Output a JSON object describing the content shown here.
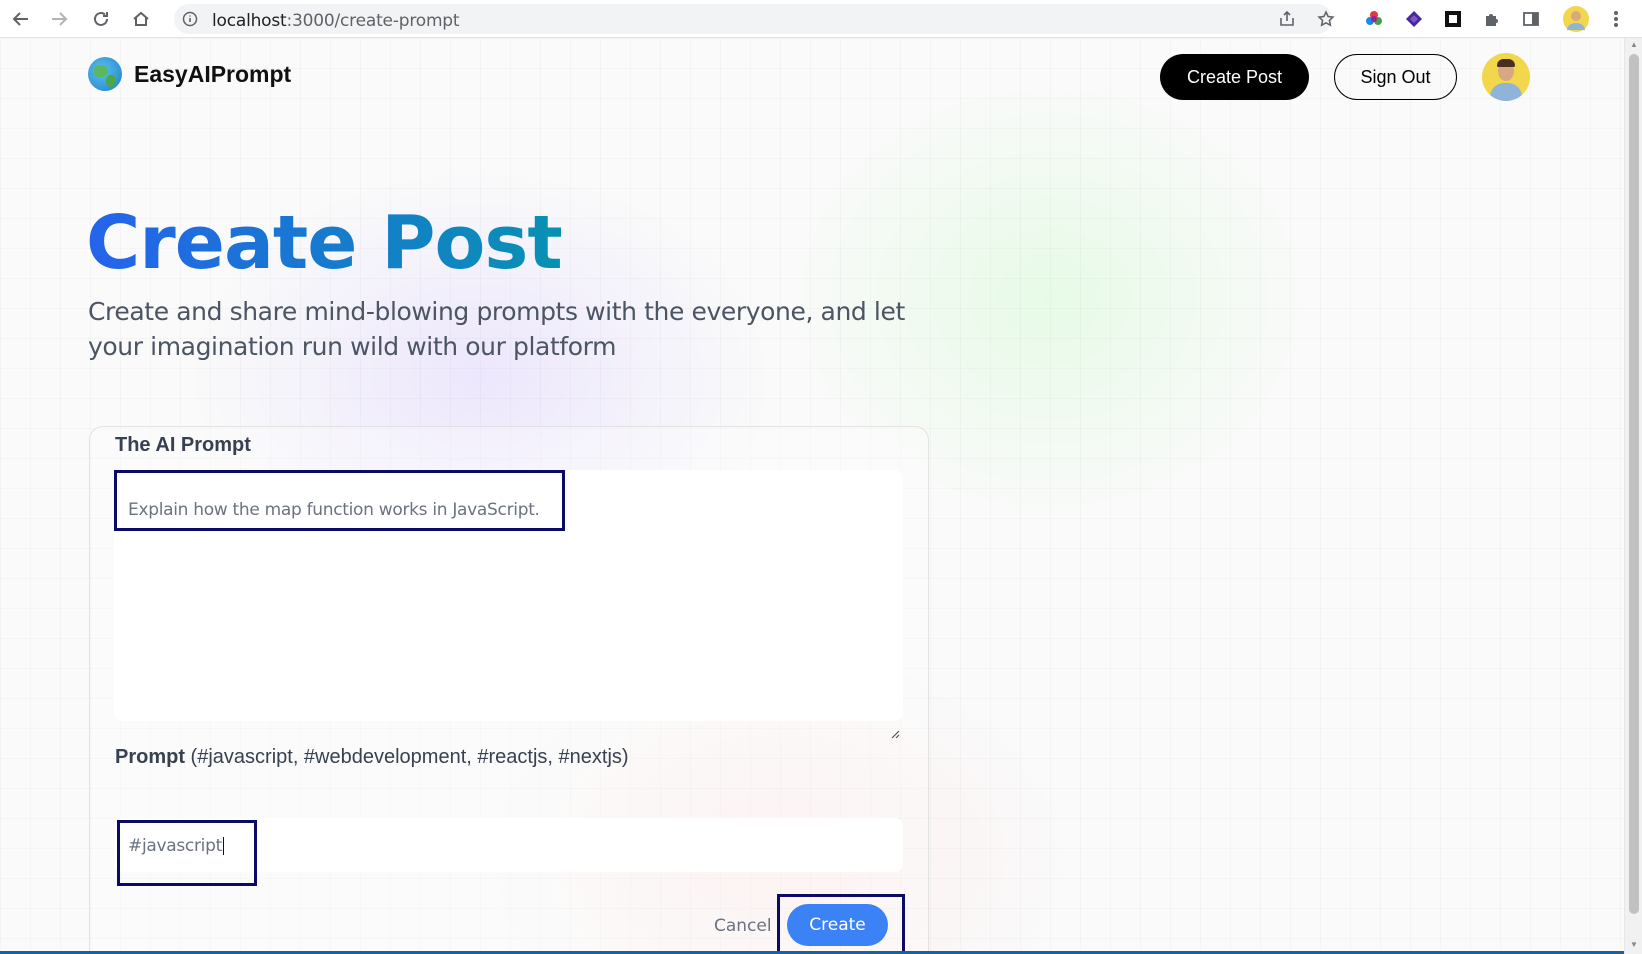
{
  "browser": {
    "url_host": "localhost",
    "url_path": ":3000/create-prompt"
  },
  "navbar": {
    "brand": "EasyAIPrompt",
    "create_post_label": "Create Post",
    "sign_out_label": "Sign Out"
  },
  "hero": {
    "title": "Create Post",
    "description": "Create and share mind-blowing prompts with the everyone, and let your imagination run wild with our platform"
  },
  "form": {
    "prompt_label": "The AI Prompt",
    "prompt_value": "Explain how the map function works in JavaScript.",
    "tag_label_bold": "Prompt",
    "tag_label_hint": " (#javascript, #webdevelopment, #reactjs, #nextjs)",
    "tag_value": "#javascript",
    "cancel_label": "Cancel",
    "create_label": "Create"
  },
  "colors": {
    "accent": "#3b82f6",
    "highlight_box": "#0b0b66",
    "title_gradient_start": "#2563eb",
    "title_gradient_end": "#0891b2"
  }
}
